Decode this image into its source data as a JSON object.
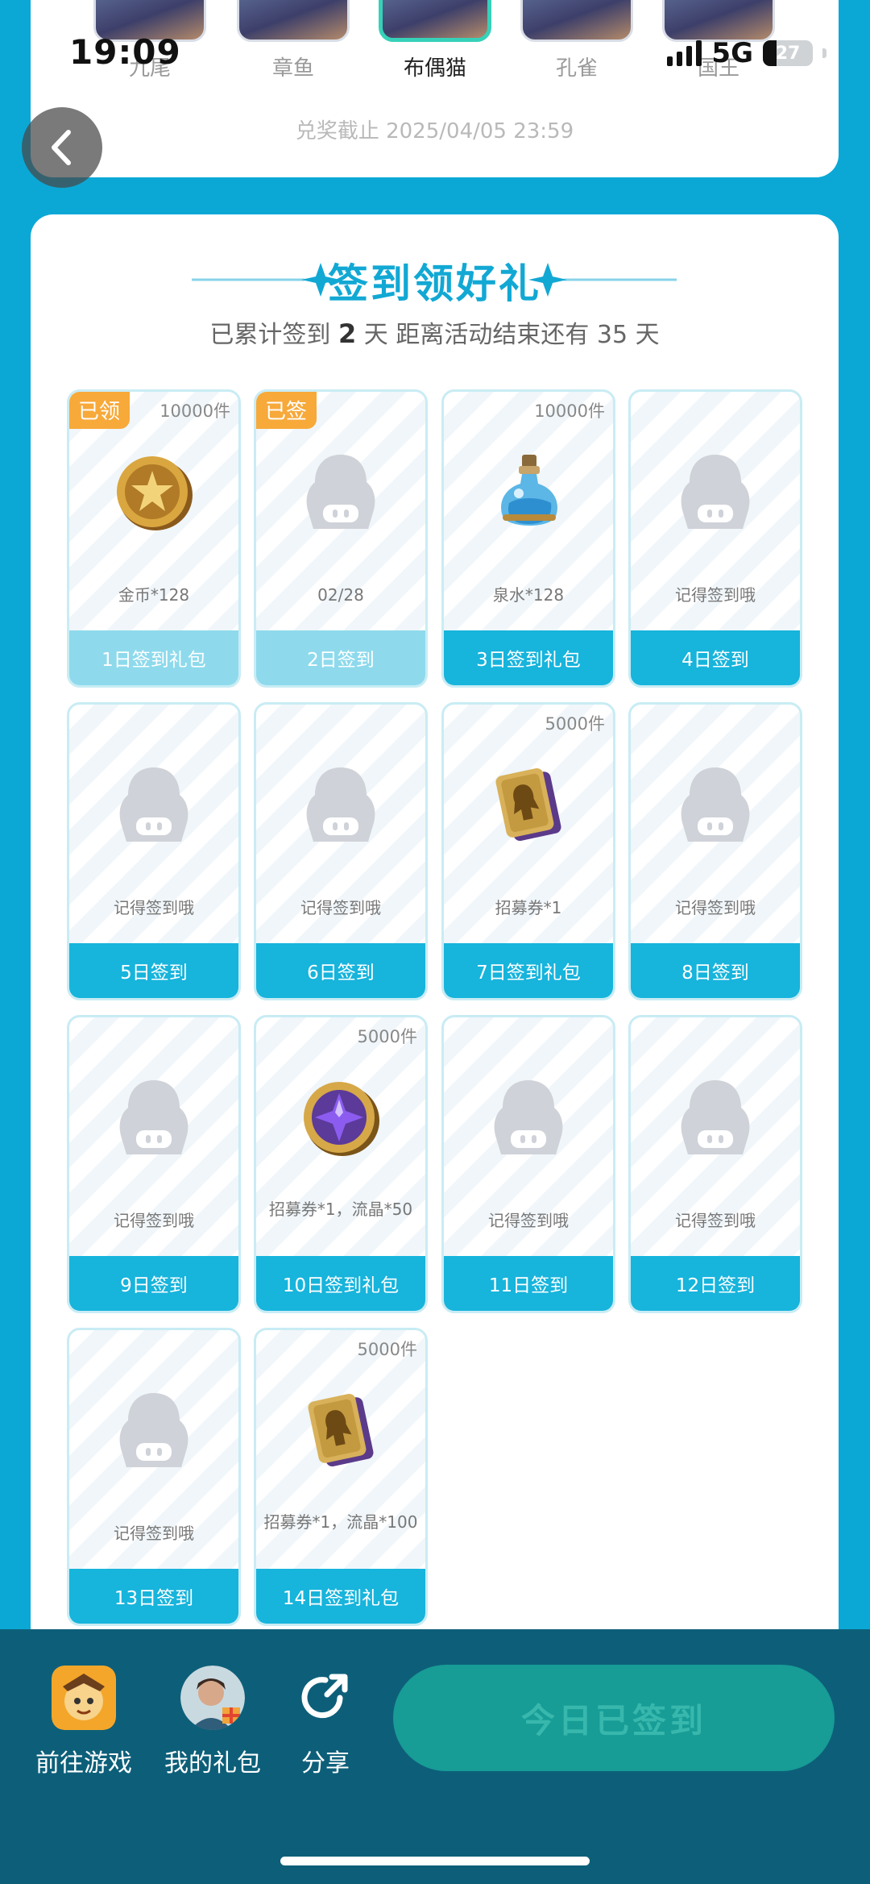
{
  "status_bar": {
    "time": "19:09",
    "network": "5G",
    "battery": "27"
  },
  "heroes": [
    {
      "name": "九尾",
      "active": false
    },
    {
      "name": "章鱼",
      "active": false
    },
    {
      "name": "布偶猫",
      "active": true
    },
    {
      "name": "孔雀",
      "active": false
    },
    {
      "name": "国王",
      "active": false
    }
  ],
  "deadline": "兑奖截止 2025/04/05 23:59",
  "checkin": {
    "title": "签到领好礼",
    "subtitle_prefix": "已累计签到",
    "days_signed": "2",
    "subtitle_mid": "天  距离活动结束还有 35 天",
    "cells": [
      {
        "tag": "已领",
        "stock": "10000件",
        "text": "金币*128",
        "button": "1日签到礼包",
        "icon": "gold-coin-icon",
        "state": "claimed"
      },
      {
        "tag": "已签",
        "stock": "",
        "text": "02/28",
        "button": "2日签到",
        "icon": "mascot-placeholder-icon",
        "state": "claimed"
      },
      {
        "tag": "",
        "stock": "10000件",
        "text": "泉水*128",
        "button": "3日签到礼包",
        "icon": "spring-water-potion-icon",
        "state": "open"
      },
      {
        "tag": "",
        "stock": "",
        "text": "记得签到哦",
        "button": "4日签到",
        "icon": "mascot-placeholder-icon",
        "state": "open"
      },
      {
        "tag": "",
        "stock": "",
        "text": "记得签到哦",
        "button": "5日签到",
        "icon": "mascot-placeholder-icon",
        "state": "open"
      },
      {
        "tag": "",
        "stock": "",
        "text": "记得签到哦",
        "button": "6日签到",
        "icon": "mascot-placeholder-icon",
        "state": "open"
      },
      {
        "tag": "",
        "stock": "5000件",
        "text": "招募券*1",
        "button": "7日签到礼包",
        "icon": "recruit-ticket-icon",
        "state": "open"
      },
      {
        "tag": "",
        "stock": "",
        "text": "记得签到哦",
        "button": "8日签到",
        "icon": "mascot-placeholder-icon",
        "state": "open"
      },
      {
        "tag": "",
        "stock": "",
        "text": "记得签到哦",
        "button": "9日签到",
        "icon": "mascot-placeholder-icon",
        "state": "open"
      },
      {
        "tag": "",
        "stock": "5000件",
        "text": "招募券*1，流晶*50",
        "button": "10日签到礼包",
        "icon": "crystal-coin-icon",
        "state": "open"
      },
      {
        "tag": "",
        "stock": "",
        "text": "记得签到哦",
        "button": "11日签到",
        "icon": "mascot-placeholder-icon",
        "state": "open"
      },
      {
        "tag": "",
        "stock": "",
        "text": "记得签到哦",
        "button": "12日签到",
        "icon": "mascot-placeholder-icon",
        "state": "open"
      },
      {
        "tag": "",
        "stock": "",
        "text": "记得签到哦",
        "button": "13日签到",
        "icon": "mascot-placeholder-icon",
        "state": "open"
      },
      {
        "tag": "",
        "stock": "5000件",
        "text": "招募券*1，流晶*100",
        "button": "14日签到礼包",
        "icon": "recruit-ticket-icon",
        "state": "open"
      }
    ]
  },
  "bottom_bar": {
    "go_game": "前往游戏",
    "my_gifts": "我的礼包",
    "share": "分享",
    "signed_today": "今日已签到"
  },
  "colors": {
    "background": "#0ba8d6",
    "accent": "#12a8d4",
    "claimed_tag": "#f7a93a",
    "bottom_bar": "#0d5f79",
    "signed_button": "#179c96"
  }
}
